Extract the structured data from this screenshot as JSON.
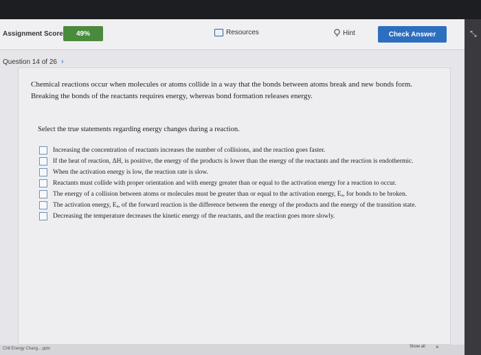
{
  "topbar": {
    "score_label": "Assignment Score:",
    "score_value": "49%",
    "resources_label": "Resources",
    "hint_label": "Hint",
    "check_label": "Check Answer"
  },
  "question_nav": {
    "label": "Question 14 of 26"
  },
  "question": {
    "intro": "Chemical reactions occur when molecules or atoms collide in a way that the bonds between atoms break and new bonds form. Breaking the bonds of the reactants requires energy, whereas bond formation releases energy.",
    "prompt": "Select the true statements regarding energy changes during a reaction.",
    "options": [
      "Increasing the concentration of reactants increases the number of collisions, and the reaction goes faster.",
      "If the heat of reaction, ΔH, is positive, the energy of the products is lower than the energy of the reactants and the reaction is endothermic.",
      "When the activation energy is low, the reaction rate is slow.",
      "Reactants must collide with proper orientation and with energy greater than or equal to the activation energy for a reaction to occur.",
      "The energy of a collision between atoms or molecules must be greater than or equal to the activation energy, Eₐ, for bonds to be broken.",
      "The activation energy, Eₐ, of the forward reaction is the difference between the energy of the products and the energy of the transition state.",
      "Decreasing the temperature decreases the kinetic energy of the reactants, and the reaction goes more slowly."
    ]
  },
  "bottom": {
    "tab_label": "Ch8 Energy Chang....pptx",
    "show_all": "Show all",
    "close": "×"
  },
  "colors": {
    "score": "#4a8a3c",
    "check_button": "#2d6fbf"
  }
}
